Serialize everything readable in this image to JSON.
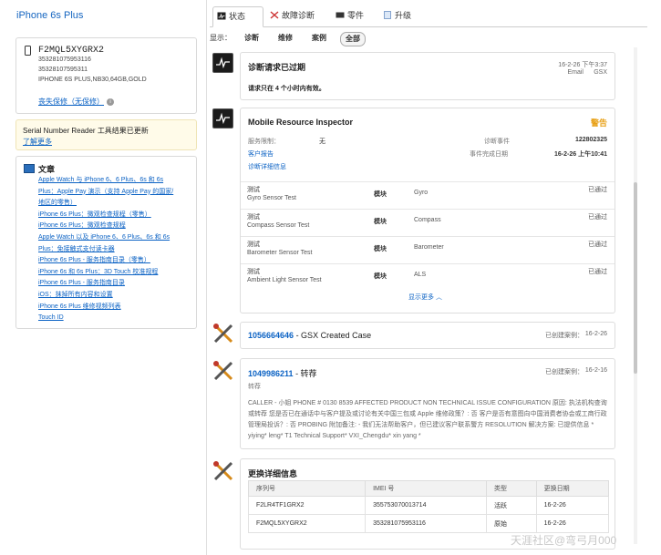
{
  "device": {
    "title": "iPhone 6s Plus",
    "serial": "F2MQL5XYGRX2",
    "imei1": "353281075953116",
    "imei2": "35328107595311",
    "config": "IPHONE 6S PLUS,NB30,64GB,GOLD",
    "warranty": "丧失保修（无保修）"
  },
  "notice": {
    "title": "Serial Number Reader 工具结果已更新",
    "link": "了解更多"
  },
  "docs": {
    "title": "文章",
    "items": [
      "Apple Watch 与 iPhone 6、6 Plus、6s 和 6s",
      "Plus：Apple Pay 演示（支持 Apple Pay 的国家/",
      "地区的零售）",
      "iPhone 6s Plus：微观检查规程（零售）",
      "iPhone 6s Plus：微观检查规程",
      "Apple Watch 以及 iPhone 6、6 Plus、6s 和 6s",
      "Plus：免接触式支付读卡器",
      "iPhone 6s Plus - 服务指南目录（零售）",
      "iPhone 6s 和 6s Plus：3D Touch 校准规程",
      "iPhone 6s Plus - 服务指南目录",
      "iOS：抹掉所有内容和设置",
      "iPhone 6s Plus 维修视频列表",
      "Touch ID"
    ]
  },
  "tabs": [
    "状态",
    "故障诊断",
    "零件",
    "升级"
  ],
  "filter": {
    "label": "显示：",
    "options": [
      "诊断",
      "维修",
      "案例",
      "全部"
    ]
  },
  "p1": {
    "title": "诊断请求已过期",
    "date": "16-2-26 下午3:37",
    "type1": "Email",
    "type2": "GSX",
    "body": "请求只在 4 个小时内有效。"
  },
  "p2": {
    "title": "Mobile Resource Inspector",
    "status": "警告",
    "limit_label": "服务限制：",
    "limit_value": "无",
    "event_label": "诊断事件",
    "event_value": "122802325",
    "report_link": "客户报告",
    "finish_label": "事件完成日期",
    "finish_value": "16-2-26 上午10:41",
    "detail_link": "诊断详细信息",
    "test_label": "测试",
    "module_label": "模块",
    "tests": [
      {
        "name": "Gyro Sensor Test",
        "module": "Gyro",
        "result": "已通过"
      },
      {
        "name": "Compass Sensor Test",
        "module": "Compass",
        "result": "已通过"
      },
      {
        "name": "Barometer Sensor Test",
        "module": "Barometer",
        "result": "已通过"
      },
      {
        "name": "Ambient Light Sensor Test",
        "module": "ALS",
        "result": "已通过"
      }
    ],
    "more": "显示更多 ︿"
  },
  "p3": {
    "case_no": "1056664646",
    "case_title": " - GSX Created Case",
    "status": "已创建案例：",
    "date": "16-2-26"
  },
  "p4": {
    "case_no": "1049986211",
    "case_title": " - 转荐",
    "status": "已创建案例：",
    "date": "16-2-16",
    "sub": "转荐",
    "body": "CALLER -      小姐 PHONE # 0130        8539 AFFECTED PRODUCT NON TECHNICAL ISSUE CONFIGURATION 原因: 执法机构查询或转荐 您是否已在通话中与客户提及或讨论有关中国三包或 Apple 维修政策？: 否 客户是否有意图向中国消费者协会或工商行政管理局投诉？: 否 PROBING 附加备注: - 我们无法帮助客户，但已建议客户联系警方 RESOLUTION 解决方案: 已提供信息 * yiying* leng* T1 Technical Support* VXI_Chengdu* xin yang *"
  },
  "p5": {
    "title": "更换详细信息",
    "headers": [
      "序列号",
      "IMEI 号",
      "类型",
      "更换日期"
    ],
    "rows": [
      [
        "F2LR4TF1GRX2",
        "355753070013714",
        "活跃",
        "16-2-26"
      ],
      [
        "F2MQL5XYGRX2",
        "353281075953116",
        "原始",
        "16-2-26"
      ]
    ]
  },
  "watermark": "天涯社区@弯弓月000"
}
